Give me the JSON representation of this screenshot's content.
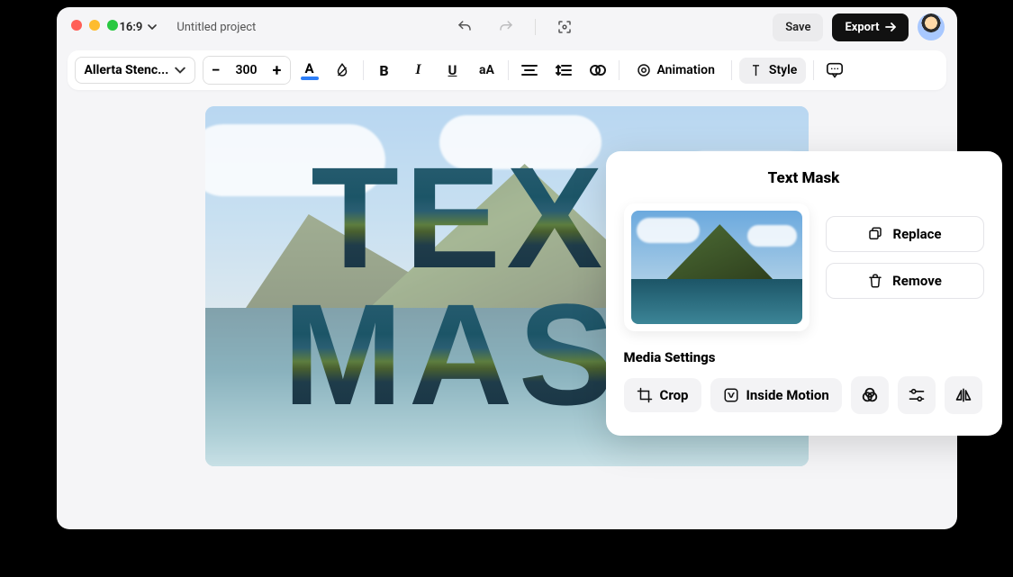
{
  "topbar": {
    "aspect": "16:9",
    "project_title": "Untitled project",
    "save_label": "Save",
    "export_label": "Export"
  },
  "toolbar": {
    "font_name": "Allerta Stenc...",
    "font_size": "300",
    "text_color": "#2d7ef7",
    "bold": "B",
    "italic": "I",
    "underline": "U",
    "case": "aA",
    "animation_label": "Animation",
    "style_label": "Style"
  },
  "canvas": {
    "line1": "TEXT",
    "line2": "MASK"
  },
  "panel": {
    "title": "Text Mask",
    "replace_label": "Replace",
    "remove_label": "Remove",
    "media_settings_label": "Media Settings",
    "crop_label": "Crop",
    "inside_motion_label": "Inside Motion"
  }
}
